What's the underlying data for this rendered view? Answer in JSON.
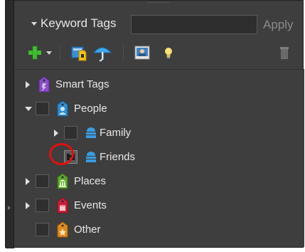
{
  "panel": {
    "title": "Keyword Tags",
    "search_value": "",
    "search_placeholder": "",
    "apply_label": "Apply"
  },
  "toolbar": {
    "tools": [
      {
        "name": "new-tag-button",
        "icon": "plus-icon"
      },
      {
        "name": "new-tag-menu-button",
        "icon": "chevron-down-icon"
      },
      {
        "name": "edit-tag-button",
        "icon": "edit-tag-icon"
      },
      {
        "name": "find-button",
        "icon": "umbrella-icon"
      },
      {
        "name": "image-tag-button",
        "icon": "photo-icon"
      },
      {
        "name": "auto-suggest-button",
        "icon": "lightbulb-icon"
      },
      {
        "name": "delete-button",
        "icon": "trash-icon"
      }
    ]
  },
  "tree": {
    "items": [
      {
        "label": "Smart Tags",
        "expanded": false,
        "icon": "smart-tag-icon",
        "icon_color": "#8a4fc7",
        "checkbox": false
      },
      {
        "label": "People",
        "expanded": true,
        "icon": "people-icon",
        "icon_color": "#2e8fd6",
        "checkbox": true
      },
      {
        "label": "Family",
        "expanded": false,
        "icon": "person-tag-icon",
        "icon_color": "#3a9be0",
        "checkbox": true
      },
      {
        "label": "Friends",
        "expanded": null,
        "icon": "person-tag-icon",
        "icon_color": "#3a9be0",
        "checkbox": "find-person"
      },
      {
        "label": "Places",
        "expanded": false,
        "icon": "places-icon",
        "icon_color": "#5aa82a",
        "checkbox": true
      },
      {
        "label": "Events",
        "expanded": false,
        "icon": "events-icon",
        "icon_color": "#c8203a",
        "checkbox": true
      },
      {
        "label": "Other",
        "expanded": null,
        "icon": "other-icon",
        "icon_color": "#e08a1e",
        "checkbox": true
      }
    ]
  },
  "colors": {
    "panel_bg": "#3e3e3e",
    "text": "#e8e8e8",
    "highlight_circle": "#e01010",
    "add_green": "#3fbf2f"
  }
}
